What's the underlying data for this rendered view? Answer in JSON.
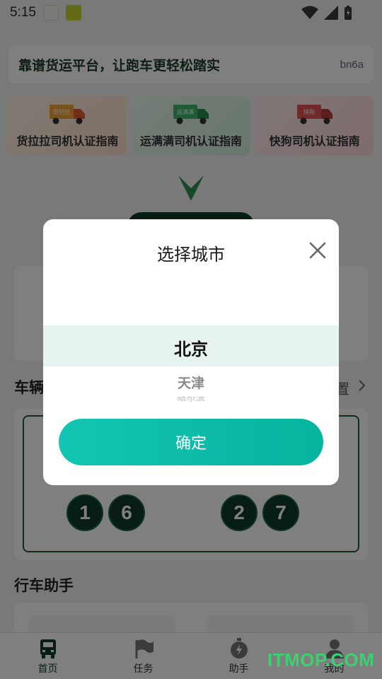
{
  "status_bar": {
    "time": "5:15"
  },
  "banner": {
    "slogan": "靠谱货运平台，让跑车更轻松踏实",
    "code": "bn6a"
  },
  "guides": [
    {
      "label": "货拉拉司机认证指南",
      "truck_sign": "货拉拉"
    },
    {
      "label": "运满满司机认证指南",
      "truck_sign": "运满满"
    },
    {
      "label": "快狗司机认证指南",
      "truck_sign": "快狗"
    }
  ],
  "vehicle": {
    "section_partial": "车辆",
    "settings_partial": "置",
    "plate_left": [
      "1",
      "6"
    ],
    "plate_right": [
      "2",
      "7"
    ]
  },
  "assistant_section": {
    "title": "行车助手"
  },
  "tabbar": {
    "items": [
      {
        "label": "首页",
        "icon": "truck-icon"
      },
      {
        "label": "任务",
        "icon": "flag-icon"
      },
      {
        "label": "助手",
        "icon": "stopwatch-icon"
      },
      {
        "label": "我的",
        "icon": "person-icon"
      }
    ],
    "active": 0
  },
  "dialog": {
    "title": "选择城市",
    "selected": "北京",
    "next_options": [
      "天津",
      "哈尔滨"
    ],
    "confirm_label": "确定"
  },
  "watermark": "ITMOP.COM",
  "colors": {
    "accent": "#0BBCA8",
    "brand_dark": "#0F3A28",
    "selection_bg": "#E6F3F1"
  }
}
